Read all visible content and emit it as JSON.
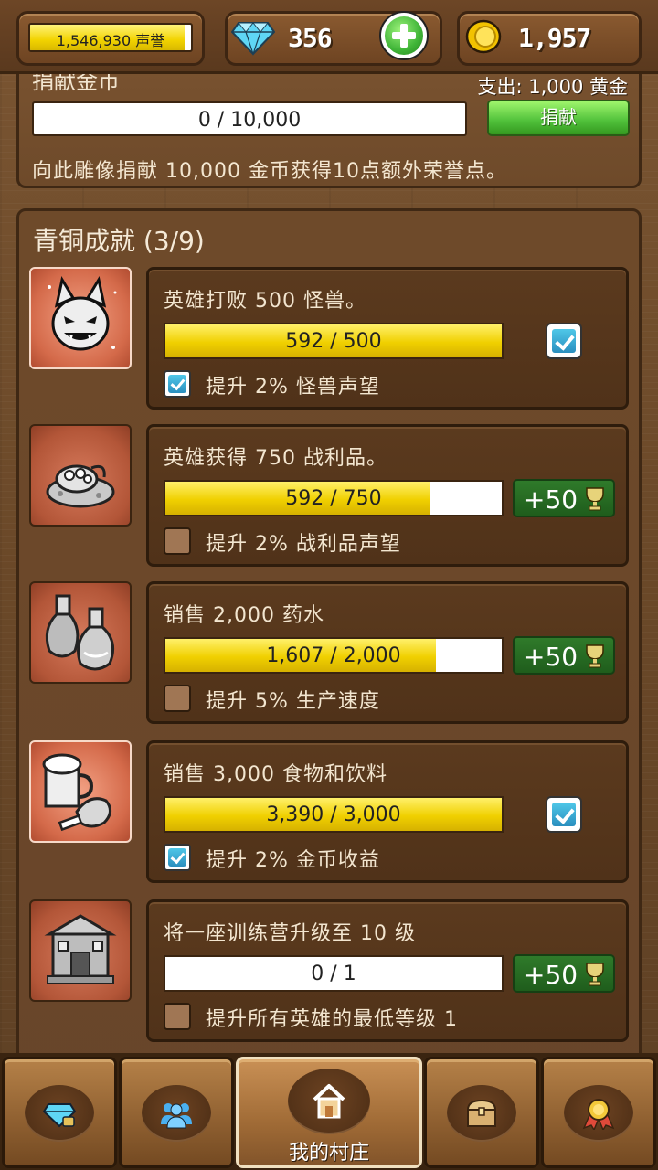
{
  "header": {
    "fame": {
      "value": "1,546,930",
      "label": "声誉",
      "fill": 0.96
    },
    "gems": "356",
    "gold": "1,957"
  },
  "donate": {
    "title": "捐献金币",
    "cost": "支出: 1,000 黄金",
    "progress_text": "0 / 10,000",
    "button": "捐献",
    "description": "向此雕像捐献 10,000 金币获得10点额外荣誉点。"
  },
  "achievements": {
    "title": "青铜成就 (3/9)",
    "items": [
      {
        "icon": "demon-face-icon",
        "desc": "英雄打败 500 怪兽。",
        "progress": "592 / 500",
        "fill": 1.0,
        "complete": true,
        "reward": "",
        "bonus": "提升 2% 怪兽声望",
        "bonus_checked": true
      },
      {
        "icon": "loot-pile-icon",
        "desc": "英雄获得 750 战利品。",
        "progress": "592 / 750",
        "fill": 0.789,
        "complete": false,
        "reward": "+50",
        "bonus": "提升 2% 战利品声望",
        "bonus_checked": false
      },
      {
        "icon": "potion-bottles-icon",
        "desc": "销售 2,000 药水",
        "progress": "1,607 / 2,000",
        "fill": 0.8035,
        "complete": false,
        "reward": "+50",
        "bonus": "提升 5% 生产速度",
        "bonus_checked": false
      },
      {
        "icon": "food-drink-icon",
        "desc": "销售 3,000 食物和饮料",
        "progress": "3,390 / 3,000",
        "fill": 1.0,
        "complete": true,
        "reward": "",
        "bonus": "提升 2% 金币收益",
        "bonus_checked": true
      },
      {
        "icon": "training-camp-icon",
        "desc": "将一座训练营升级至 10 级",
        "progress": "0 / 1",
        "fill": 0.0,
        "complete": false,
        "reward": "+50",
        "bonus": "提升所有英雄的最低等级 1",
        "bonus_checked": false
      }
    ]
  },
  "bottom_nav": [
    {
      "icon": "diamond-icon",
      "label": ""
    },
    {
      "icon": "heroes-icon",
      "label": ""
    },
    {
      "icon": "home-icon",
      "label": "我的村庄",
      "active": true
    },
    {
      "icon": "treasure-chest-icon",
      "label": ""
    },
    {
      "icon": "medal-icon",
      "label": ""
    }
  ]
}
